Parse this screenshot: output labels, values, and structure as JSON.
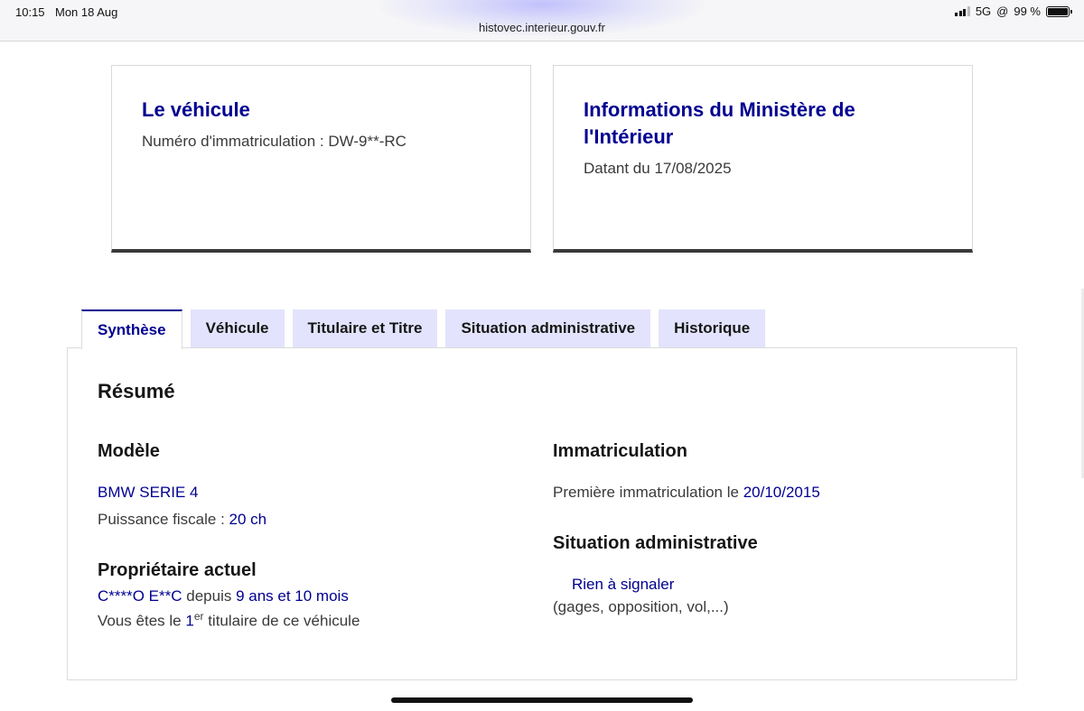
{
  "status_bar": {
    "time": "10:15",
    "date": "Mon 18 Aug",
    "network": "5G",
    "battery": "99 %",
    "url": "histovec.interieur.gouv.fr"
  },
  "cards": {
    "vehicle": {
      "title": "Le véhicule",
      "plate_label": "Numéro d'immatriculation : ",
      "plate_value": "DW-9**-RC"
    },
    "ministry": {
      "title_line1": "Informations du Ministère de",
      "title_line2": "l'Intérieur",
      "date_text": "Datant du 17/08/2025"
    }
  },
  "tabs": [
    "Synthèse",
    "Véhicule",
    "Titulaire et Titre",
    "Situation administrative",
    "Historique"
  ],
  "summary": {
    "heading": "Résumé",
    "model": {
      "heading": "Modèle",
      "name": "BMW SERIE 4",
      "power_label": "Puissance fiscale : ",
      "power_value": "20 ch"
    },
    "owner": {
      "heading": "Propriétaire actuel",
      "name": "C****O E**C",
      "since_label": " depuis ",
      "duration": "9 ans et 10 mois",
      "rank_prefix": "Vous êtes le ",
      "rank_number": "1",
      "rank_suffix": "er",
      "rank_rest": " titulaire de ce véhicule"
    },
    "registration": {
      "heading": "Immatriculation",
      "label": "Première immatriculation le ",
      "date": "20/10/2015"
    },
    "admin": {
      "heading": "Situation administrative",
      "status": "Rien à signaler",
      "detail": "(gages, opposition, vol,...)"
    }
  },
  "colors": {
    "accent": "#000091",
    "tab_bg": "#e3e3fd",
    "text": "#3a3a3a"
  }
}
